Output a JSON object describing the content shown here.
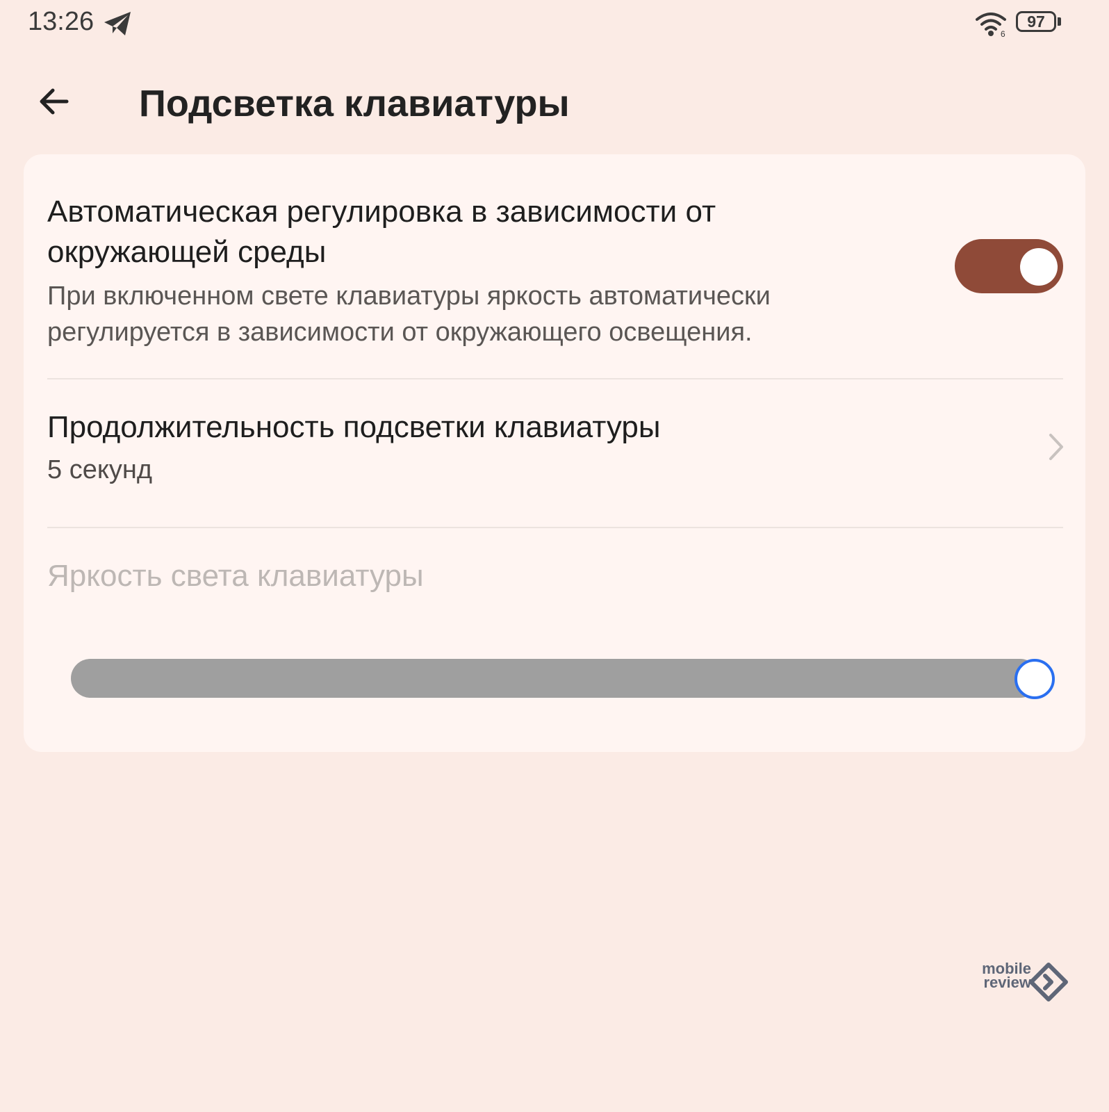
{
  "status_bar": {
    "time": "13:26",
    "battery": "97",
    "icons": [
      "telegram-icon",
      "wifi-icon",
      "battery-icon"
    ]
  },
  "header": {
    "title": "Подсветка клавиатуры",
    "back_icon": "arrow-left-icon"
  },
  "settings": {
    "auto_adjust": {
      "title": "Автоматическая регулировка в зависимости от окружающей среды",
      "description": "При включенном свете клавиатуры яркость автоматически регулируется в зависимости от окружающего освещения.",
      "enabled": true
    },
    "duration": {
      "title": "Продолжительность подсветки клавиатуры",
      "value": "5 секунд",
      "icon": "chevron-right-icon"
    },
    "brightness": {
      "label": "Яркость света клавиатуры",
      "level": 1.0,
      "disabled": true
    }
  },
  "watermark": {
    "line1": "mobile",
    "line2": "review"
  },
  "colors": {
    "background": "#fbebe5",
    "card": "#fff5f2",
    "toggle_on": "#8f4a38",
    "slider_track": "#9f9f9f",
    "slider_thumb_border": "#2a6ff0"
  }
}
